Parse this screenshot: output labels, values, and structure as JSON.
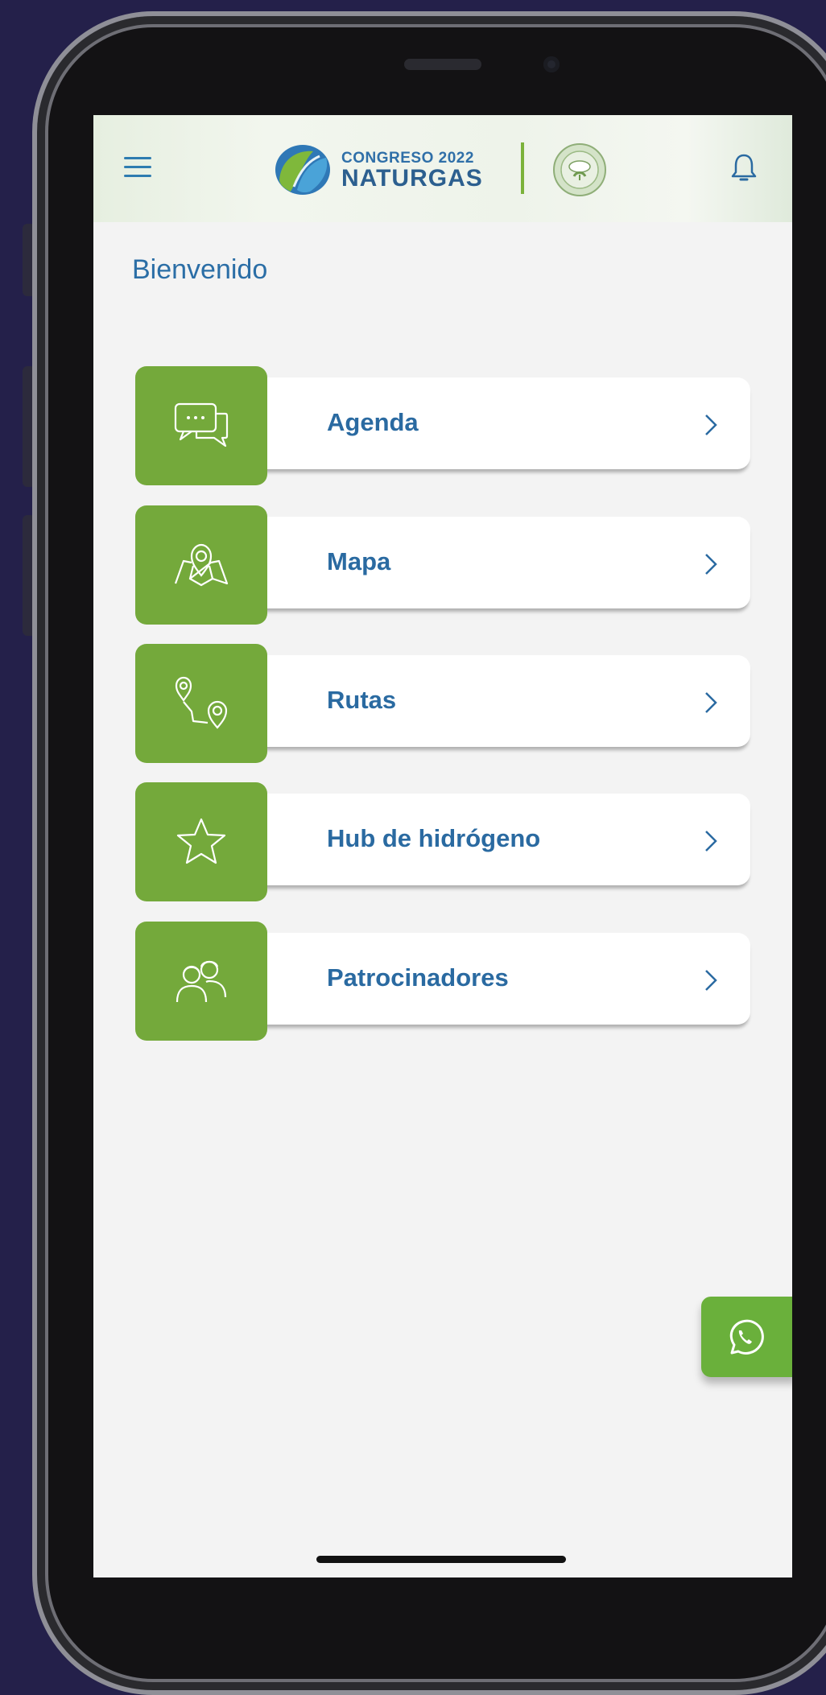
{
  "header": {
    "logo_line1": "CONGRESO 2022",
    "logo_line2": "NATURGAS"
  },
  "welcome_title": "Bienvenido",
  "menu": [
    {
      "label": "Agenda",
      "icon": "chat-bubbles-icon"
    },
    {
      "label": "Mapa",
      "icon": "map-pin-icon"
    },
    {
      "label": "Rutas",
      "icon": "route-icon"
    },
    {
      "label": "Hub de hidrógeno",
      "icon": "star-icon"
    },
    {
      "label": "Patrocinadores",
      "icon": "people-icon"
    }
  ],
  "colors": {
    "accent_green": "#74a93b",
    "text_blue": "#2a6aa1",
    "background": "#f3f3f3",
    "frame_background": "#24204a"
  }
}
